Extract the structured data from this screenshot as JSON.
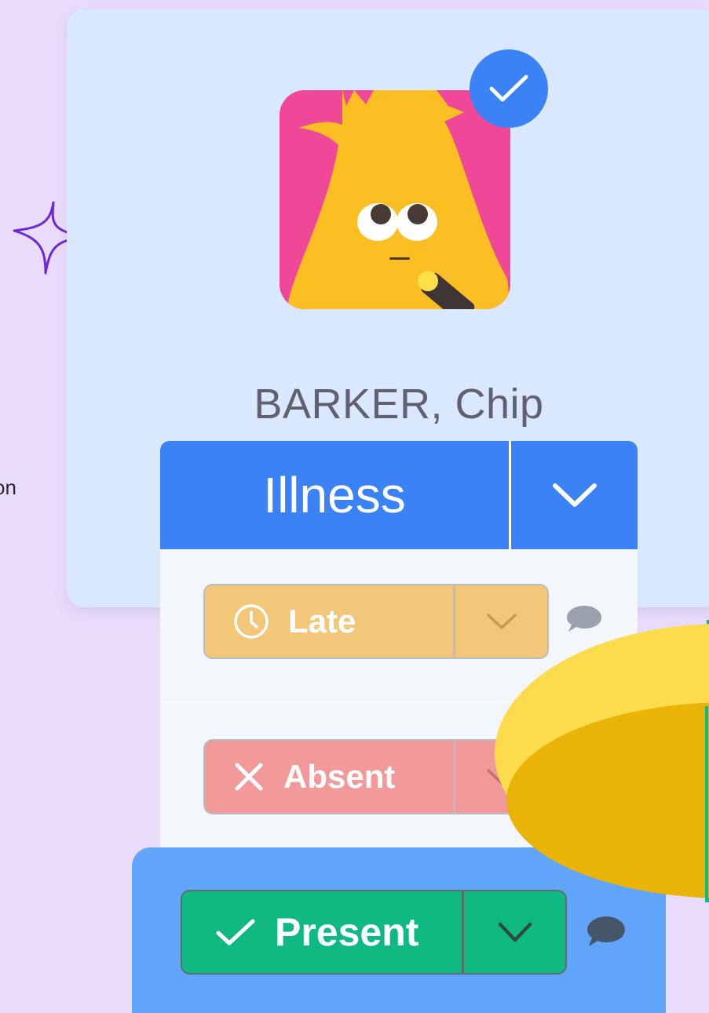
{
  "side_text": "on",
  "student": {
    "name": "BARKER, Chip"
  },
  "status": {
    "current": "Illness",
    "options": [
      {
        "label": "Late",
        "icon": "clock-icon",
        "color": "#f3c77a"
      },
      {
        "label": "Absent",
        "icon": "x-icon",
        "color": "#f29a99"
      },
      {
        "label": "Present",
        "icon": "check-icon",
        "color": "#10b981"
      }
    ]
  },
  "colors": {
    "accent": "#3b82f6",
    "card_bg": "#d9e8fe",
    "page_bg": "#e9dcfb",
    "selected_bg": "#60a5fa"
  }
}
